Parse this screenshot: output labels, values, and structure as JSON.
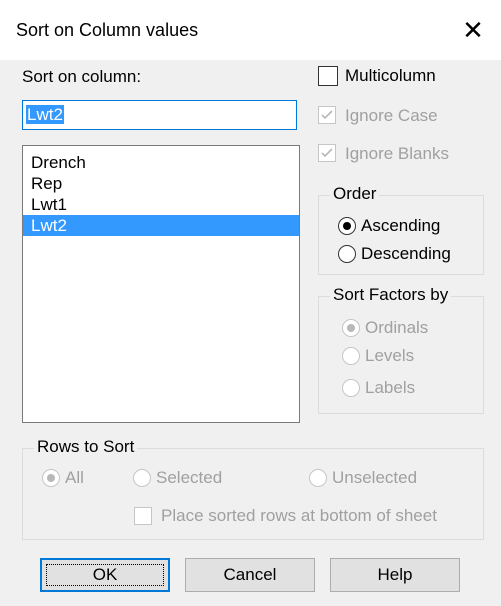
{
  "window": {
    "title": "Sort on Column values"
  },
  "sort_column": {
    "label": "Sort on column:",
    "input_value": "Lwt2",
    "list": [
      "Drench",
      "Rep",
      "Lwt1",
      "Lwt2"
    ],
    "selected": "Lwt2"
  },
  "options": {
    "multicolumn": "Multicolumn",
    "ignore_case": "Ignore Case",
    "ignore_blanks": "Ignore Blanks"
  },
  "order": {
    "legend": "Order",
    "ascending": "Ascending",
    "descending": "Descending",
    "selected": "Ascending"
  },
  "sort_factors": {
    "legend": "Sort Factors by",
    "ordinals": "Ordinals",
    "levels": "Levels",
    "labels": "Labels",
    "selected": "Ordinals"
  },
  "rows_to_sort": {
    "legend": "Rows to Sort",
    "all": "All",
    "selected_rows": "Selected",
    "unselected": "Unselected",
    "selected": "All",
    "place_bottom": "Place sorted rows at bottom of sheet"
  },
  "buttons": {
    "ok": "OK",
    "cancel": "Cancel",
    "help": "Help"
  },
  "colors": {
    "selection": "#3399ff",
    "focus_border": "#0078d7",
    "dialog_bg": "#f0f0f0",
    "disabled_text": "#a0a0a0"
  }
}
